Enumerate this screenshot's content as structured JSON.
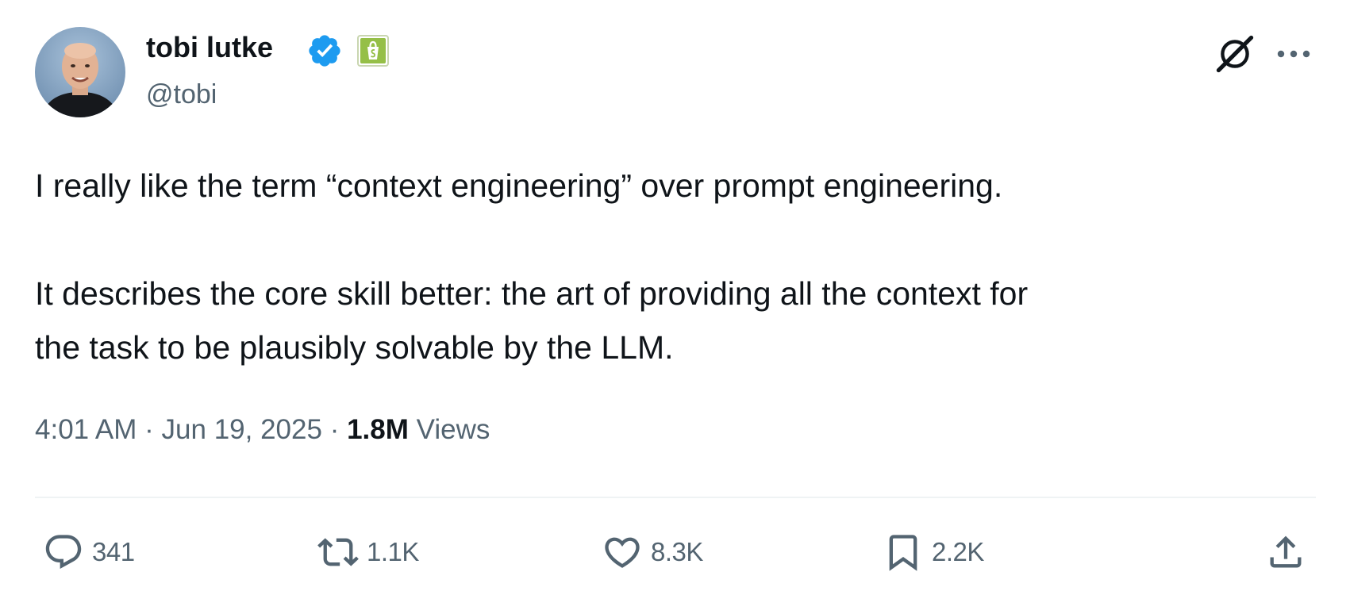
{
  "author": {
    "display_name": "tobi lutke",
    "handle": "@tobi",
    "verified_color": "#1d9bf0",
    "affiliate_badge_color": "#95bf47"
  },
  "header_icons": {
    "grok": "grok-icon",
    "more": "more-icon"
  },
  "tweet": {
    "lines": [
      "I really like the term “context engineering” over prompt engineering.",
      "It describes the core skill better: the art of providing all the context for",
      "the task to be plausibly solvable by the LLM."
    ]
  },
  "meta": {
    "time": "4:01 AM",
    "separator": "·",
    "date": "Jun 19, 2025",
    "views_count": "1.8M",
    "views_label": "Views"
  },
  "actions": {
    "replies": "341",
    "reposts": "1.1K",
    "likes": "8.3K",
    "bookmarks": "2.2K"
  }
}
